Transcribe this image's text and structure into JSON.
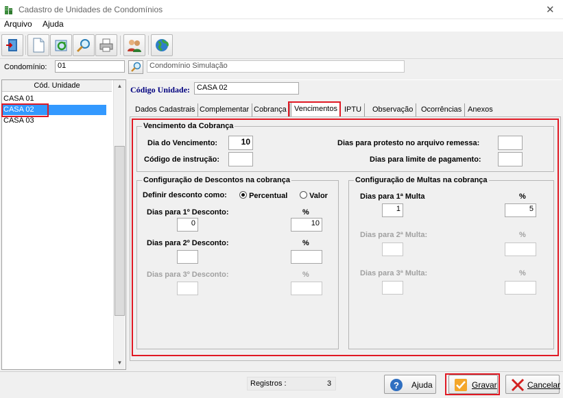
{
  "window": {
    "title": "Cadastro de Unidades de Condomínios"
  },
  "menu": {
    "arquivo": "Arquivo",
    "ajuda": "Ajuda"
  },
  "toolbar": {
    "icons": [
      "exit-door-icon",
      "new-document-icon",
      "refresh-icon",
      "search-icon",
      "print-icon",
      "users-icon",
      "globe-icon"
    ]
  },
  "condominio": {
    "label": "Condomínio:",
    "code": "01",
    "name": "Condomínio Simulação"
  },
  "unit_list": {
    "header": "Cód. Unidade",
    "items": [
      "CASA 01",
      "CASA 02",
      "CASA 03"
    ],
    "selected": "CASA 02"
  },
  "codigo_unidade": {
    "label": "Código Unidade:",
    "value": "CASA 02"
  },
  "tabs": [
    "Dados Cadastrais",
    "Complementar",
    "Cobrança",
    "Vencimentos",
    "IPTU",
    "Observação",
    "Ocorrências",
    "Anexos"
  ],
  "active_tab": "Vencimentos",
  "vencimento": {
    "legend": "Vencimento da  Cobrança",
    "dia_label": "Dia do Vencimento:",
    "dia_value": "10",
    "instrucao_label": "Código de instrução:",
    "instrucao_value": "",
    "protesto_label": "Dias para protesto no arquivo remessa:",
    "protesto_value": "",
    "limite_label": "Dias para limite de pagamento:",
    "limite_value": ""
  },
  "descontos": {
    "legend": "Configuração de Descontos na cobrança",
    "definir_label": "Definir desconto como:",
    "opt_percentual": "Percentual",
    "opt_valor": "Valor",
    "selected": "Percentual",
    "pct_header": "%",
    "d1_label": "Dias para 1º Desconto:",
    "d1_days": "0",
    "d1_pct": "10",
    "d2_label": "Dias para 2º Desconto:",
    "d2_days": "",
    "d2_pct": "",
    "d3_label": "Dias para 3º Desconto:",
    "d3_days": "",
    "d3_pct": ""
  },
  "multas": {
    "legend": "Configuração de Multas na cobrança",
    "pct_header": "%",
    "m1_label": "Dias para 1ª Multa",
    "m1_days": "1",
    "m1_pct": "5",
    "m2_label": "Dias para 2ª Multa:",
    "m2_days": "",
    "m2_pct": "",
    "m3_label": "Dias para 3ª Multa:",
    "m3_days": "",
    "m3_pct": ""
  },
  "status": {
    "registros_label": "Registros :",
    "registros_value": "3"
  },
  "buttons": {
    "ajuda": "Ajuda",
    "gravar": "Gravar",
    "cancelar": "Cancelar"
  },
  "colors": {
    "highlight_red": "#e01823",
    "selection_blue": "#3399ff",
    "title_blue": "#00007f"
  }
}
